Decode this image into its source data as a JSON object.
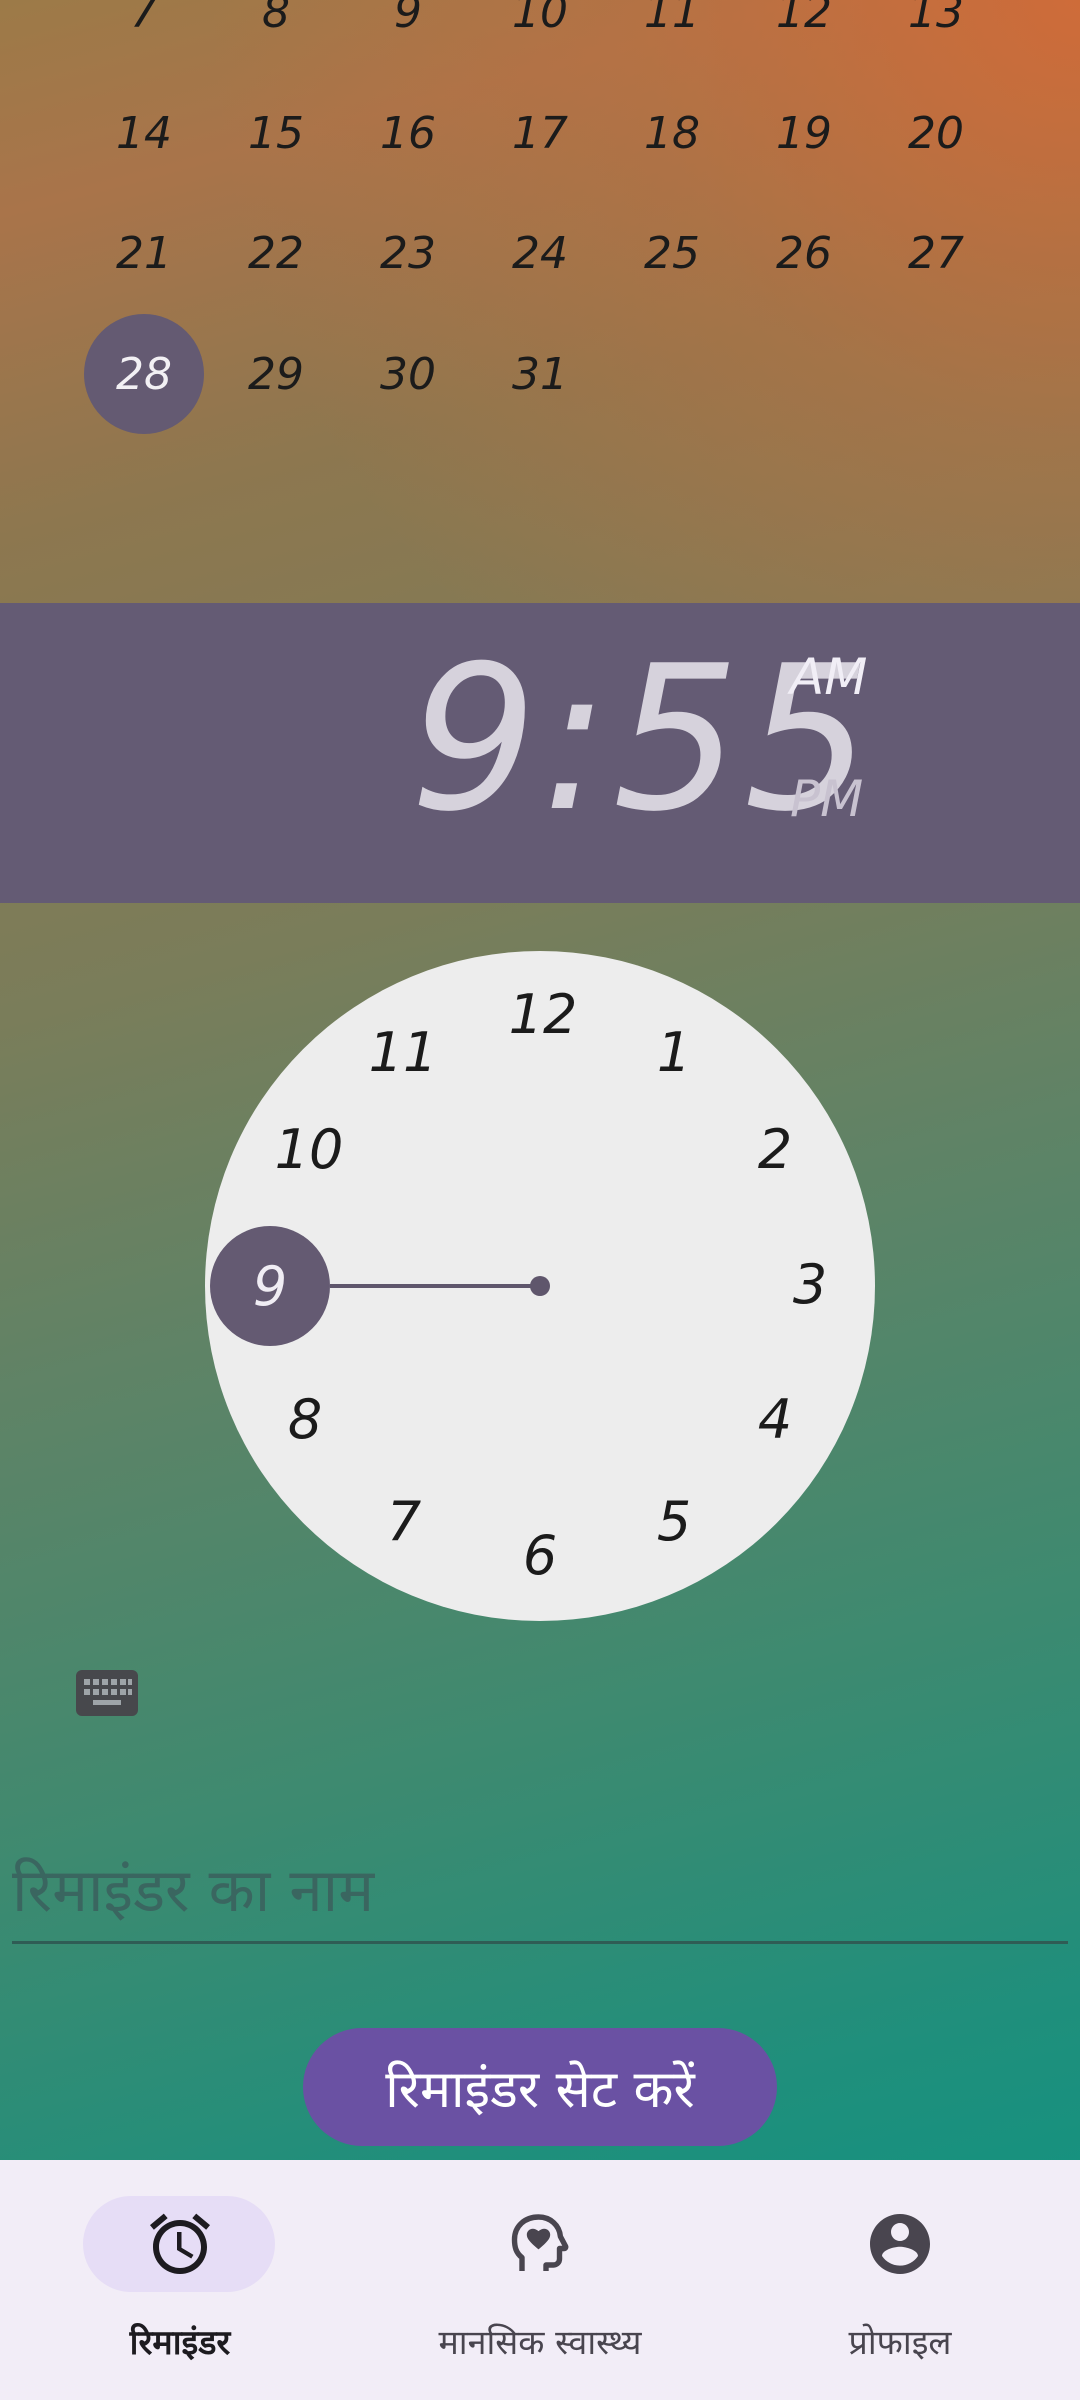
{
  "calendar": {
    "rows": [
      [
        "7",
        "8",
        "9",
        "10",
        "11",
        "12",
        "13"
      ],
      [
        "14",
        "15",
        "16",
        "17",
        "18",
        "19",
        "20"
      ],
      [
        "21",
        "22",
        "23",
        "24",
        "25",
        "26",
        "27"
      ],
      [
        "28",
        "29",
        "30",
        "31"
      ]
    ],
    "selected_day": "28"
  },
  "time": {
    "display": "9:55",
    "am": "AM",
    "pm": "PM",
    "selected_period": "AM"
  },
  "clock": {
    "numbers": [
      "12",
      "1",
      "2",
      "3",
      "4",
      "5",
      "6",
      "7",
      "8",
      "9",
      "10",
      "11"
    ],
    "selected": "9"
  },
  "reminder": {
    "name_placeholder": "रिमाइंडर का नाम",
    "set_button": "रिमाइंडर सेट करें"
  },
  "nav": {
    "items": [
      {
        "label": "रिमाइंडर",
        "icon": "alarm-clock-icon",
        "active": true
      },
      {
        "label": "मानसिक स्वास्थ्य",
        "icon": "mental-health-icon",
        "active": false
      },
      {
        "label": "प्रोफाइल",
        "icon": "account-circle-icon",
        "active": false
      }
    ]
  },
  "colors": {
    "selected": "#645a72",
    "time_band": "#645b74",
    "button": "#6a51a3",
    "nav_bg": "#f2edf7",
    "nav_pill": "#e6ddf6"
  }
}
